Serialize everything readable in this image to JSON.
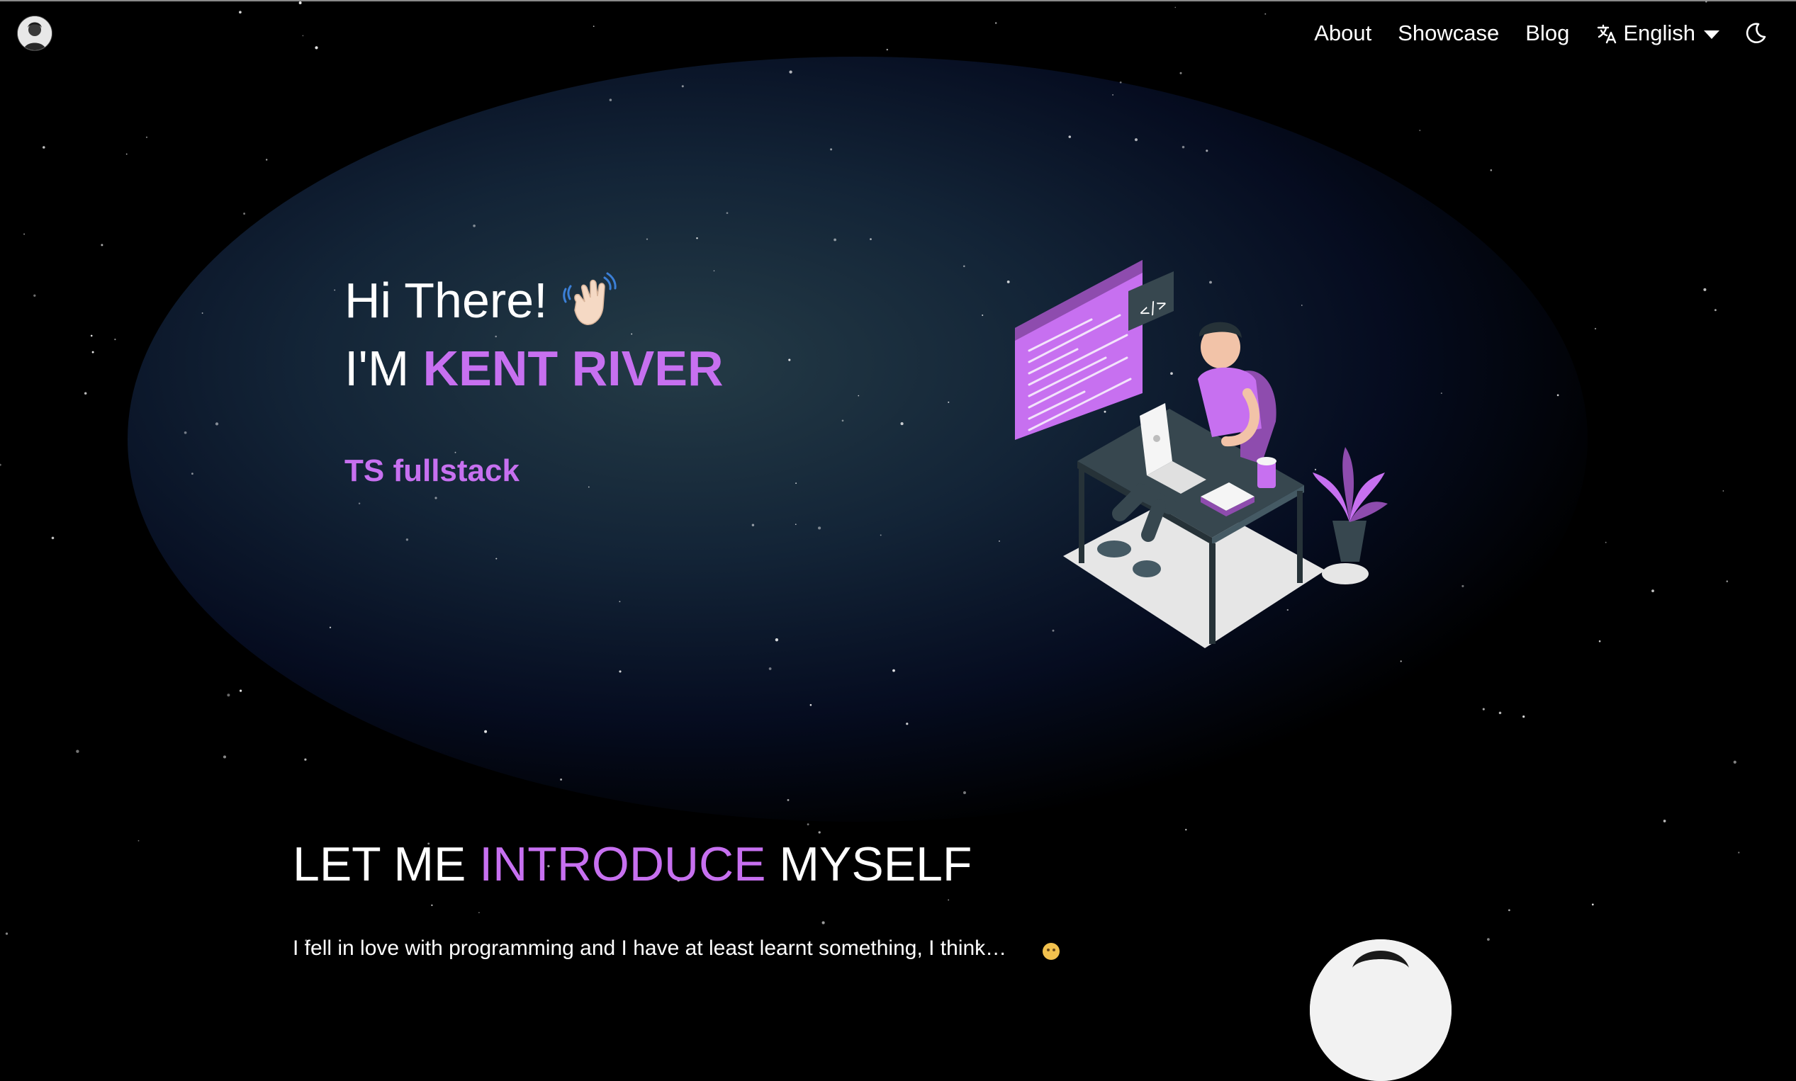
{
  "nav": {
    "links": [
      "About",
      "Showcase",
      "Blog"
    ],
    "language": "English",
    "icons": {
      "avatar": "profile-avatar",
      "language": "translate-icon",
      "dropdown": "chevron-down-icon",
      "theme": "moon-icon"
    }
  },
  "hero": {
    "greeting": "Hi There!",
    "greeting_icon": "waving-hand-icon",
    "im": "I'M",
    "name": "KENT RIVER",
    "role": "TS fullstack"
  },
  "intro": {
    "title_pre": "LET ME",
    "title_highlight": "INTRODUCE",
    "title_post": "MYSELF",
    "text": "I fell in love with programming and I have at least learnt something, I think…"
  },
  "colors": {
    "accent": "#c770f0",
    "background": "#000000",
    "text": "#ffffff"
  }
}
